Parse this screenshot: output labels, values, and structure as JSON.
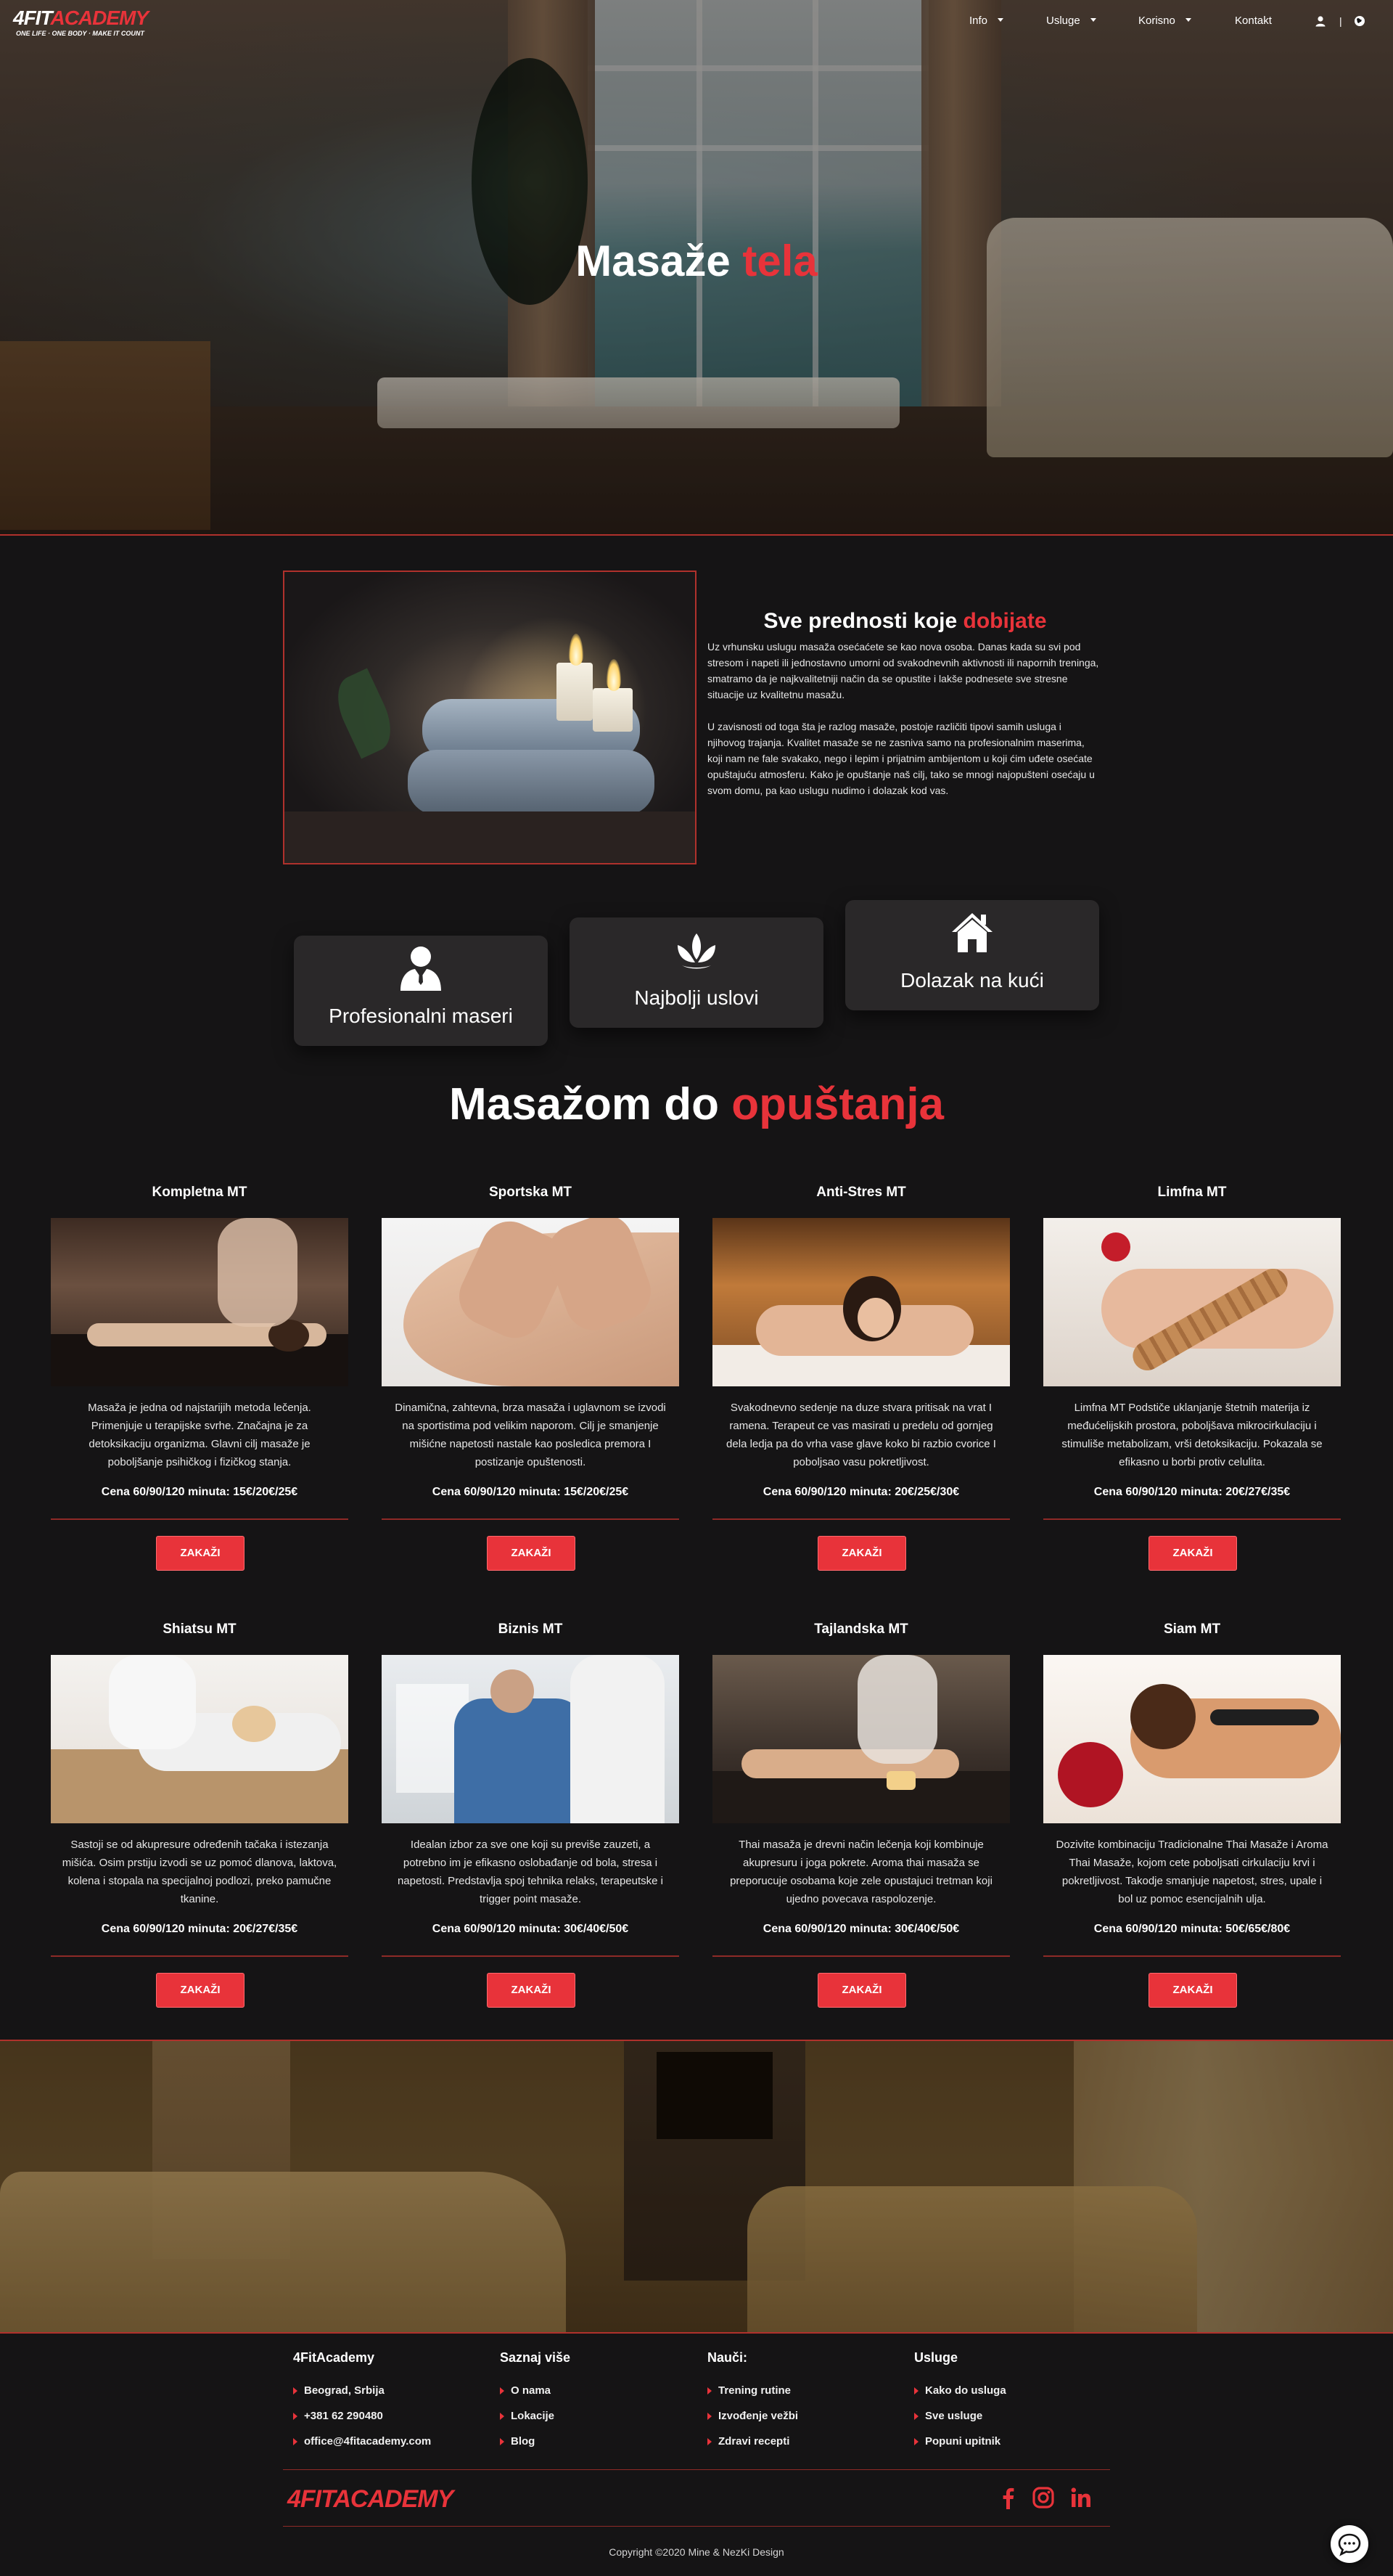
{
  "brand": {
    "logo_white": "4FIT",
    "logo_red": "ACADEMY",
    "logo_tagline": "ONE LIFE · ONE BODY · MAKE IT COUNT"
  },
  "nav": {
    "items": [
      {
        "label": "Info",
        "dropdown": true
      },
      {
        "label": "Usluge",
        "dropdown": true
      },
      {
        "label": "Korisno",
        "dropdown": true
      },
      {
        "label": "Kontakt",
        "dropdown": false
      }
    ],
    "separator": "|",
    "icons": [
      "user-icon",
      "globe-icon"
    ]
  },
  "hero": {
    "title_main": "Masaže",
    "title_accent": "tela"
  },
  "about": {
    "title_main": "Sve prednosti koje",
    "title_accent": "dobijate",
    "paragraphs": [
      "Uz vrhunsku uslugu masaža osećaćete se kao nova osoba. Danas kada su svi pod stresom i napeti ili jednostavno umorni od svakodnevnih aktivnosti ili napornih treninga, smatramo da je najkvalitetniji način da se opustite i lakše podnesete sve stresne situacije uz kvalitetnu masažu.",
      "U zavisnosti od toga šta je razlog masaže, postoje različiti tipovi samih usluga i njihovog trajanja. Kvalitet masaže se ne zasniva samo na profesionalnim maserima, koji nam ne fale svakako, nego i lepim i prijatnim ambijentom u koji ćim uđete osećate opuštajuću atmosferu. Kako je opuštanje naš cilj, tako se mnogi najopušteni osećaju u svom domu, pa kao uslugu nudimo i dolazak kod vas."
    ]
  },
  "features": [
    {
      "label": "Profesionalni maseri",
      "icon": "person-icon"
    },
    {
      "label": "Najbolji uslovi",
      "icon": "lotus-icon"
    },
    {
      "label": "Dolazak na kući",
      "icon": "house-icon"
    }
  ],
  "services": {
    "title_main": "Masažom do",
    "title_accent": "opuštanja",
    "items": [
      {
        "name": "Kompletna MT",
        "description": "Masaža je jedna od najstarijih metoda lečenja. Primenjuje u terapijske svrhe. Značajna je za detoksikaciju organizma. Glavni cilj masaže je poboljšanje psihičkog i fizičkog stanja.",
        "price": "Cena 60/90/120 minuta: 15€/20€/25€",
        "button": "ZAKAŽI"
      },
      {
        "name": "Sportska MT",
        "description": "Dinamična, zahtevna, brza masaža i uglavnom se izvodi na sportistima pod velikim naporom. Cilj je smanjenje mišićne napetosti nastale kao posledica premora I postizanje opuštenosti.",
        "price": "Cena 60/90/120 minuta: 15€/20€/25€",
        "button": "ZAKAŽI"
      },
      {
        "name": "Anti-Stres MT",
        "description": "Svakodnevno sedenje na duze stvara pritisak na vrat I ramena. Terapeut ce vas masirati u predelu od gornjeg dela ledja pa do vrha vase glave koko bi razbio cvorice I poboljsao vasu pokretljivost.",
        "price": "Cena 60/90/120 minuta: 20€/25€/30€",
        "button": "ZAKAŽI"
      },
      {
        "name": "Limfna MT",
        "description": "Limfna MT Podstiče uklanjanje štetnih materija iz međućelijskih prostora, poboljšava mikrocirkulaciju i stimuliše metabolizam, vrši detoksikaciju. Pokazala se efikasno u borbi protiv celulita.",
        "price": "Cena 60/90/120 minuta: 20€/27€/35€",
        "button": "ZAKAŽI"
      },
      {
        "name": "Shiatsu MT",
        "description": "Sastoji se od akupresure određenih tačaka i istezanja mišića. Osim prstiju izvodi se uz pomoć dlanova, laktova, kolena i stopala na specijalnoj podlozi, preko pamučne tkanine.",
        "price": "Cena 60/90/120 minuta: 20€/27€/35€",
        "button": "ZAKAŽI"
      },
      {
        "name": "Biznis MT",
        "description": "Idealan izbor za sve one koji su previše zauzeti, a potrebno im je efikasno oslobađanje od bola, stresa i napetosti. Predstavlja spoj tehnika relaks, terapeutske i trigger point masaže.",
        "price": "Cena 60/90/120 minuta: 30€/40€/50€",
        "button": "ZAKAŽI"
      },
      {
        "name": "Tajlandska MT",
        "description": "Thai masaža je drevni način lečenja koji kombinuje akupresuru i joga pokrete. Aroma thai masaža se preporucuje osobama koje zele opustajuci tretman koji ujedno povecava raspolozenje.",
        "price": "Cena 60/90/120 minuta: 30€/40€/50€",
        "button": "ZAKAŽI"
      },
      {
        "name": "Siam MT",
        "description": "Dozivite kombinaciju Tradicionalne Thai Masaže i Aroma Thai Masaže, kojom cete poboljsati cirkulaciju krvi i pokretljivost. Takodje smanjuje napetost, stres, upale i bol uz pomoc esencijalnih ulja.",
        "price": "Cena 60/90/120 minuta: 50€/65€/80€",
        "button": "ZAKAŽI"
      }
    ]
  },
  "footer": {
    "columns": [
      {
        "title": "4FitAcademy",
        "links": [
          "Beograd, Srbija",
          "+381 62 290480",
          "office@4fitacademy.com"
        ]
      },
      {
        "title": "Saznaj više",
        "links": [
          "O nama",
          "Lokacije",
          "Blog"
        ]
      },
      {
        "title": "Nauči:",
        "links": [
          "Trening rutine",
          "Izvođenje vežbi",
          "Zdravi recepti"
        ]
      },
      {
        "title": "Usluge",
        "links": [
          "Kako do usluga",
          "Sve usluge",
          "Popuni upitnik"
        ]
      }
    ],
    "logo": "4FITACADEMY",
    "social": [
      "facebook-icon",
      "instagram-icon",
      "linkedin-icon"
    ],
    "copyright": "Copyright ©2020 Mine & NezKi Design"
  },
  "colors": {
    "accent": "#e8333a",
    "background": "#151415",
    "card": "#2a2829"
  }
}
